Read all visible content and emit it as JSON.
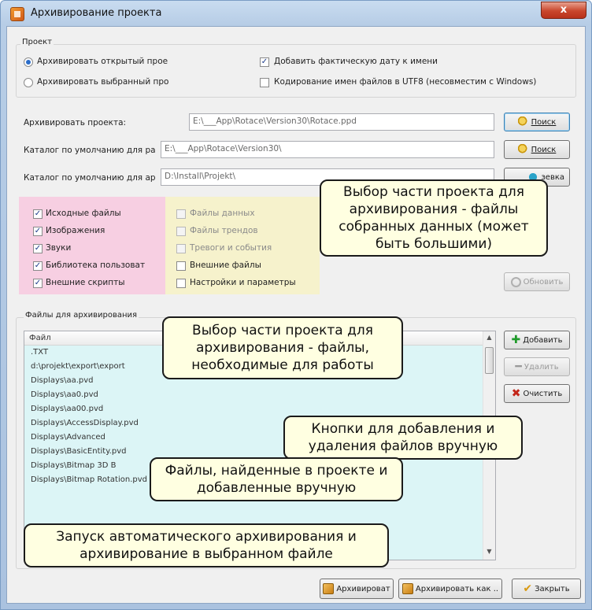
{
  "window": {
    "title": "Архивирование проекта",
    "close_label": "x"
  },
  "project_group": {
    "label": "Проект",
    "radio_open": "Архивировать открытый прое",
    "radio_selected": "Архивировать выбранный про",
    "add_date": "Добавить фактическую дату к имени",
    "utf8": "Кодирование имен файлов в UTF8 (несовместим с Windows)"
  },
  "fields": {
    "archive_label": "Архивировать проекта:",
    "archive_value": "E:\\___App\\Rotace\\Version30\\Rotace.ppd",
    "default_dir_label": "Каталог по умолчанию для ра",
    "default_dir_value": "E:\\___App\\Rotace\\Version30\\",
    "default_arch_label": "Каталог по умолчанию для ар",
    "default_arch_value": "D:\\Install\\Projekt\\"
  },
  "buttons": {
    "search1": "Поиск",
    "search2": "Поиск",
    "search3": "зевка",
    "refresh": "Обновить",
    "add": "Добавить",
    "remove": "Удалить",
    "clear": "Очистить",
    "archive": "Архивироват",
    "archive_as": "Архивировать как ..",
    "close": "Закрыть"
  },
  "checks_left": [
    "Исходные файлы",
    "Изображения",
    "Звуки",
    "Библиотека пользоват",
    "Внешние скрипты"
  ],
  "checks_right": [
    "Файлы данных",
    "Файлы трендов",
    "Тревоги и события",
    "Внешние файлы",
    "Настройки и параметры"
  ],
  "files_group": {
    "label": "Файлы для архивирования",
    "header": "Файл",
    "items": [
      ".TXT",
      "d:\\projekt\\export\\export",
      "Displays\\aa.pvd",
      "Displays\\aa0.pvd",
      "Displays\\aa00.pvd",
      "Displays\\AccessDisplay.pvd",
      "Displays\\Advanced",
      "Displays\\BasicEntity.pvd",
      "Displays\\Bitmap 3D B",
      "Displays\\Bitmap Rotation.pvd"
    ]
  },
  "callouts": {
    "data_parts": "Выбор части проекта для архивирования - файлы собранных данных (может быть большими)",
    "work_parts": "Выбор части проекта для архивирования - файлы, необходимые для работы",
    "manual_buttons": "Кнопки для добавления и удаления файлов вручную",
    "found_files": "Файлы, найденные в проекте и добавленные вручную",
    "launch": "Запуск автоматического архивирования и архивирование в выбранном файле"
  },
  "icons": {
    "search": "search-icon",
    "add": "plus-icon",
    "remove": "minus-icon",
    "clear": "x-icon",
    "close": "checkmark-icon"
  }
}
